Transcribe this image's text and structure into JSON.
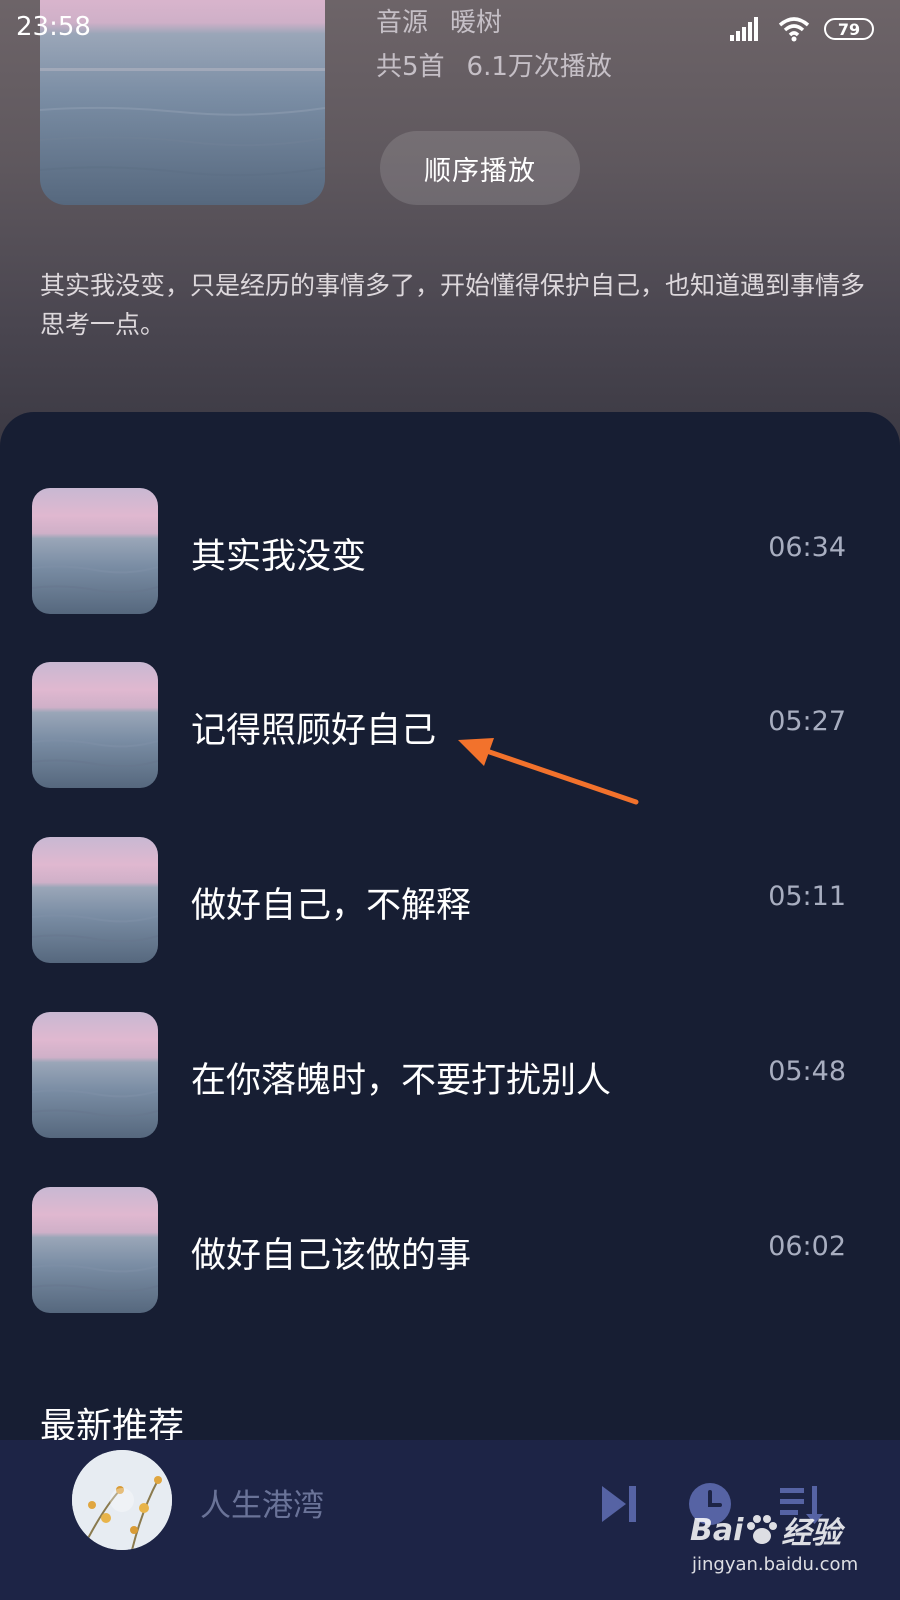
{
  "status_bar": {
    "time": "23:58",
    "battery": "79"
  },
  "album": {
    "source_label": "音源",
    "source_name": "暖树",
    "track_count": "共5首",
    "play_count": "6.1万次播放",
    "play_button": "顺序播放",
    "description": "其实我没变，只是经历的事情多了，开始懂得保护自己，也知道遇到事情多思考一点。"
  },
  "songs": [
    {
      "title": "其实我没变",
      "duration": "06:34"
    },
    {
      "title": "记得照顾好自己",
      "duration": "05:27"
    },
    {
      "title": "做好自己，不解释",
      "duration": "05:11"
    },
    {
      "title": "在你落魄时，不要打扰别人",
      "duration": "05:48"
    },
    {
      "title": "做好自己该做的事",
      "duration": "06:02"
    }
  ],
  "section_title": "最新推荐",
  "player": {
    "title": "人生港湾"
  },
  "watermark": {
    "logo_left": "Bai",
    "logo_right": "经验",
    "url": "jingyan.baidu.com"
  },
  "icons": {
    "signal": "signal-icon",
    "wifi": "wifi-icon",
    "next": "next-icon",
    "timer": "timer-icon",
    "playlist": "playlist-icon",
    "paw": "paw-icon"
  },
  "colors": {
    "panel_bg": "#171e33",
    "player_bg": "#1d2446",
    "annotation": "#f2722c",
    "player_icon": "#5663a4"
  }
}
